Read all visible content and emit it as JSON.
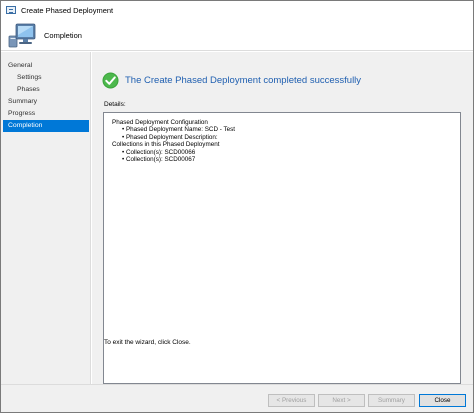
{
  "window": {
    "title": "Create Phased Deployment",
    "title_icon": "wizard-window-icon"
  },
  "header": {
    "title": "Completion",
    "icon": "computer-monitor-icon"
  },
  "sidebar": {
    "items": [
      {
        "label": "General",
        "level": 0,
        "active": false
      },
      {
        "label": "Settings",
        "level": 1,
        "active": false
      },
      {
        "label": "Phases",
        "level": 1,
        "active": false
      },
      {
        "label": "Summary",
        "level": 0,
        "active": false
      },
      {
        "label": "Progress",
        "level": 0,
        "active": false
      },
      {
        "label": "Completion",
        "level": 0,
        "active": true
      }
    ]
  },
  "main": {
    "success_message": "The Create Phased Deployment completed successfully",
    "success_icon": "green-check-icon",
    "details_label": "Details:",
    "details_lines": [
      {
        "text": "Phased Deployment Configuration",
        "indent": false
      },
      {
        "text": "• Phased Deployment Name: SCD - Test",
        "indent": true
      },
      {
        "text": "• Phased Deployment Description:",
        "indent": true
      },
      {
        "text": "Collections in this Phased Deployment",
        "indent": false
      },
      {
        "text": "• Collection(s): SCD00066",
        "indent": true
      },
      {
        "text": "• Collection(s): SCD00067",
        "indent": true
      }
    ],
    "exit_note": "To exit the wizard, click Close."
  },
  "buttons": {
    "previous": "< Previous",
    "next": "Next >",
    "summary": "Summary",
    "close": "Close"
  },
  "colors": {
    "accent": "#0078d7",
    "success_text": "#1f5fb0",
    "success_green": "#3aa33a",
    "panel_bg": "#f0f0f0"
  }
}
